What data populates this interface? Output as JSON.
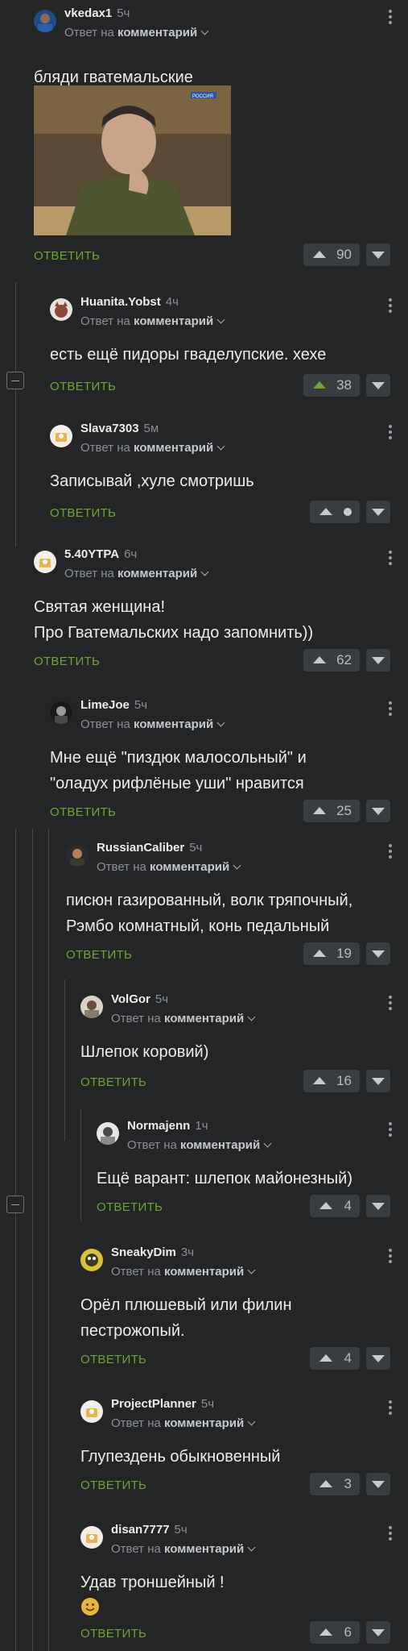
{
  "ui": {
    "reply_label": "ОТВЕТИТЬ",
    "reply_to_prefix": "Ответ на",
    "reply_to_target": "комментарий"
  },
  "comments": [
    {
      "user": "vkedax1",
      "time": "5ч",
      "text": "бляди гватемальские",
      "score": "90",
      "has_image": true
    },
    {
      "user": "Huanita.Yobst",
      "time": "4ч",
      "text": "есть ещё пидоры гваделупские. хехе",
      "score": "38"
    },
    {
      "user": "Slava7303",
      "time": "5м",
      "text": "Записывай ,хуле смотришь",
      "score": ""
    },
    {
      "user": "5.40YTPA",
      "time": "6ч",
      "text_lines": [
        "Святая женщина!",
        "Про Гватемальских надо запомнить))"
      ],
      "score": "62"
    },
    {
      "user": "LimeJoe",
      "time": "5ч",
      "text_lines": [
        "Мне ещё \"пиздюк малосольный\" и",
        "\"оладух рифлёные уши\" нравится"
      ],
      "score": "25"
    },
    {
      "user": "RussianCaliber",
      "time": "5ч",
      "text_lines": [
        "писюн газированный, волк тряпочный,",
        "Рэмбо комнатный, конь педальный"
      ],
      "score": "19"
    },
    {
      "user": "VolGor",
      "time": "5ч",
      "text": "Шлепок коровий)",
      "score": "16"
    },
    {
      "user": "Normajenn",
      "time": "1ч",
      "text": "Ещё варант: шлепок майонезный)",
      "score": "4"
    },
    {
      "user": "SneakyDim",
      "time": "3ч",
      "text_lines": [
        "Орёл плюшевый или филин",
        "пестрожопый."
      ],
      "score": "4"
    },
    {
      "user": "ProjectPlanner",
      "time": "5ч",
      "text": "Глупездень обыкновенный",
      "score": "3"
    },
    {
      "user": "disan7777",
      "time": "5ч",
      "text": "Удав троншейный !",
      "score": "6",
      "emoji": "smiley"
    }
  ],
  "image_overlay": {
    "channel_logo": "РОССИЯ"
  },
  "colors": {
    "background": "#232527",
    "accent_green": "#6ea632",
    "vote_bg": "#3a3d40"
  }
}
